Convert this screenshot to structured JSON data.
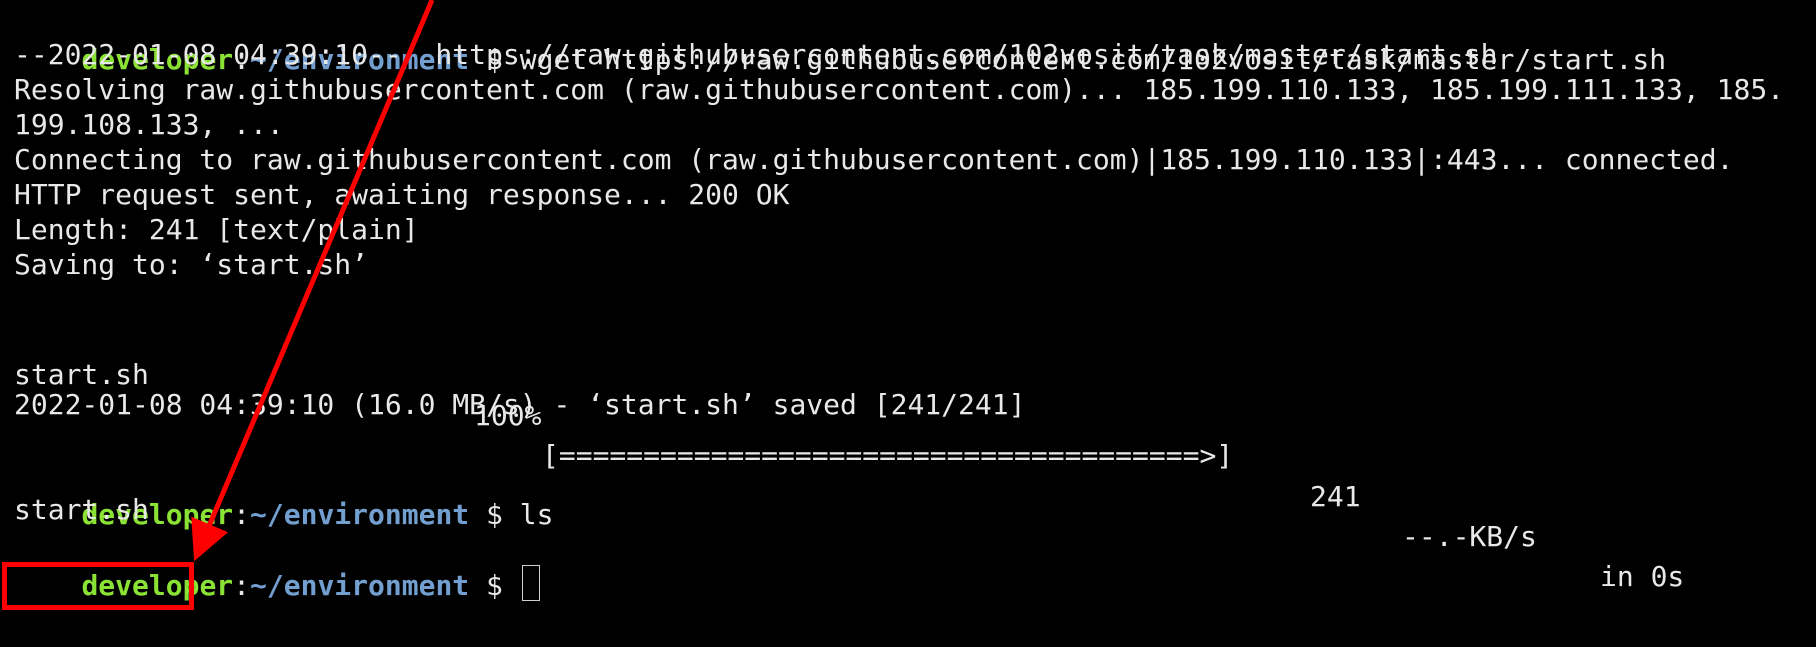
{
  "prompt": {
    "user": "developer",
    "separator": ":",
    "path": "~/environment",
    "sign": " $ "
  },
  "lines": {
    "cmd1": "wget https://raw.githubusercontent.com/102vosit/task/master/start.sh",
    "l2": "--2022-01-08 04:39:10--  https://raw.githubusercontent.com/102vosit/task/master/start.sh",
    "l3": "Resolving raw.githubusercontent.com (raw.githubusercontent.com)... 185.199.110.133, 185.199.111.133, 185.",
    "l4": "199.108.133, ...",
    "l5": "Connecting to raw.githubusercontent.com (raw.githubusercontent.com)|185.199.110.133|:443... connected.",
    "l6": "HTTP request sent, awaiting response... 200 OK",
    "l7": "Length: 241 [text/plain]",
    "l8": "Saving to: ‘start.sh’",
    "progress_file": "start.sh",
    "progress_pct": "100%",
    "progress_bar": "[======================================>]",
    "progress_size": "241",
    "progress_speed": "--.-KB/s",
    "progress_time": "in 0s",
    "l11": "2022-01-08 04:39:10 (16.0 MB/s) - ‘start.sh’ saved [241/241]",
    "cmd2": "ls",
    "ls_output": "start.sh"
  },
  "progress": {
    "fraction": 1.0
  },
  "colors": {
    "background": "#000000",
    "text": "#e8e8e8",
    "user": "#8ae234",
    "path": "#729fcf",
    "annotation": "#ff0000"
  }
}
